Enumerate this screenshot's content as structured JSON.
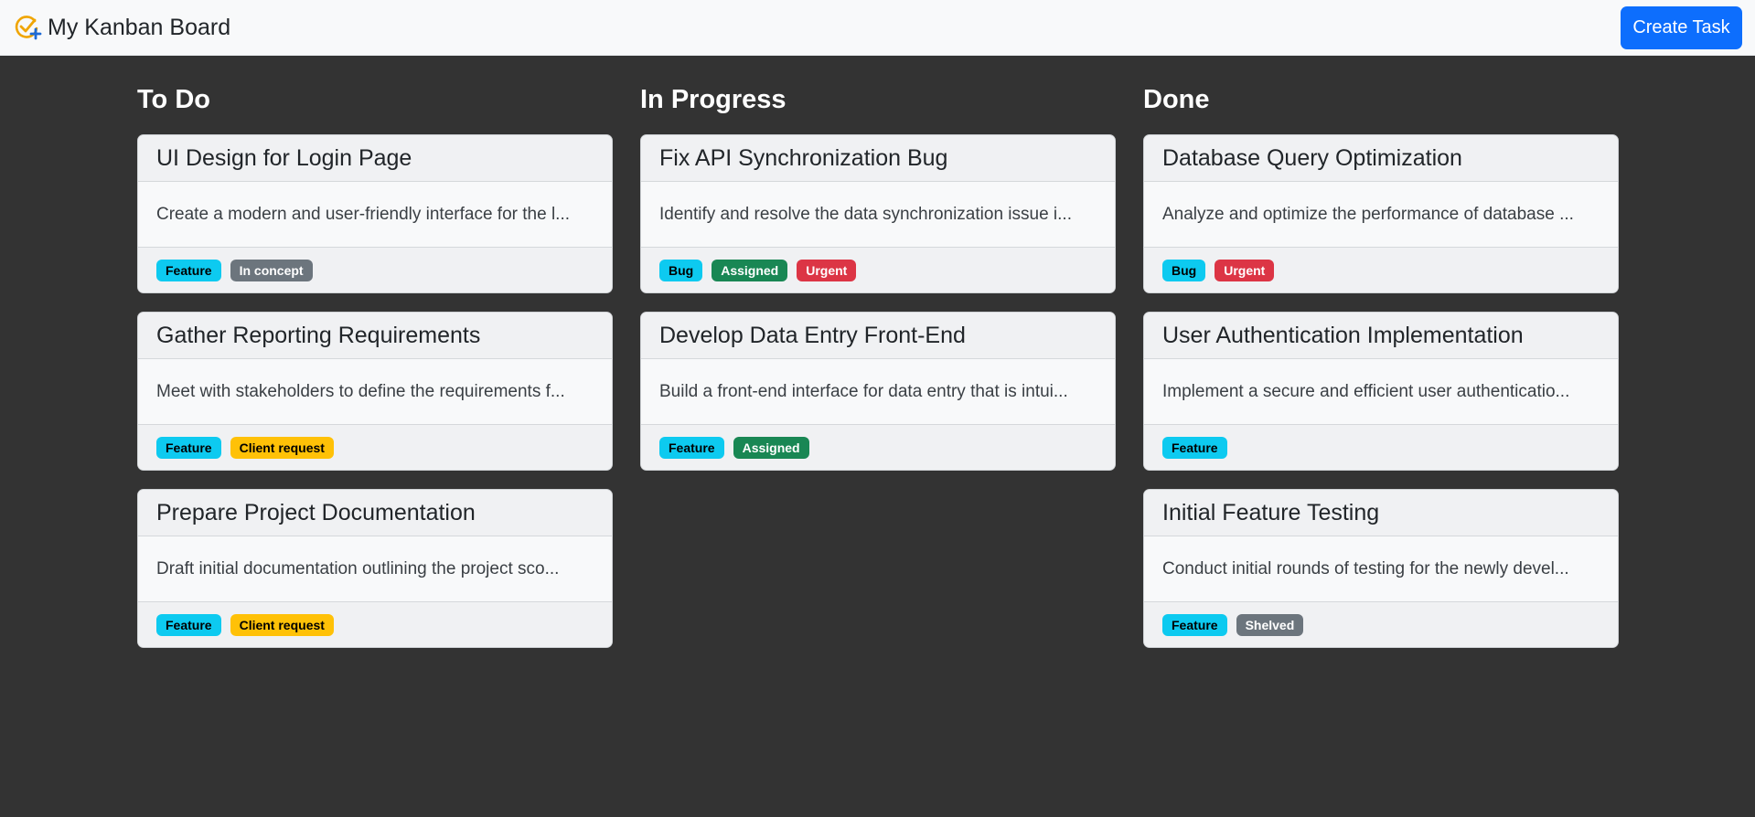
{
  "navbar": {
    "title": "My Kanban Board",
    "create_button": "Create Task"
  },
  "colors": {
    "primary": "#0d6efd",
    "info": "#0dcaf0",
    "secondary": "#6c757d",
    "success": "#198754",
    "danger": "#dc3545",
    "warning": "#ffc107",
    "background": "#333333"
  },
  "columns": [
    {
      "title": "To Do",
      "cards": [
        {
          "title": "UI Design for Login Page",
          "description": "Create a modern and user-friendly interface for the l...",
          "badges": [
            {
              "label": "Feature",
              "variant": "info"
            },
            {
              "label": "In concept",
              "variant": "secondary"
            }
          ]
        },
        {
          "title": "Gather Reporting Requirements",
          "description": "Meet with stakeholders to define the requirements f...",
          "badges": [
            {
              "label": "Feature",
              "variant": "info"
            },
            {
              "label": "Client request",
              "variant": "warning"
            }
          ]
        },
        {
          "title": "Prepare Project Documentation",
          "description": "Draft initial documentation outlining the project sco...",
          "badges": [
            {
              "label": "Feature",
              "variant": "info"
            },
            {
              "label": "Client request",
              "variant": "warning"
            }
          ]
        }
      ]
    },
    {
      "title": "In Progress",
      "cards": [
        {
          "title": "Fix API Synchronization Bug",
          "description": "Identify and resolve the data synchronization issue i...",
          "badges": [
            {
              "label": "Bug",
              "variant": "info"
            },
            {
              "label": "Assigned",
              "variant": "success"
            },
            {
              "label": "Urgent",
              "variant": "danger"
            }
          ]
        },
        {
          "title": "Develop Data Entry Front-End",
          "description": "Build a front-end interface for data entry that is intui...",
          "badges": [
            {
              "label": "Feature",
              "variant": "info"
            },
            {
              "label": "Assigned",
              "variant": "success"
            }
          ]
        }
      ]
    },
    {
      "title": "Done",
      "cards": [
        {
          "title": "Database Query Optimization",
          "description": "Analyze and optimize the performance of database ...",
          "badges": [
            {
              "label": "Bug",
              "variant": "info"
            },
            {
              "label": "Urgent",
              "variant": "danger"
            }
          ]
        },
        {
          "title": "User Authentication Implementation",
          "description": "Implement a secure and efficient user authenticatio...",
          "badges": [
            {
              "label": "Feature",
              "variant": "info"
            }
          ]
        },
        {
          "title": "Initial Feature Testing",
          "description": "Conduct initial rounds of testing for the newly devel...",
          "badges": [
            {
              "label": "Feature",
              "variant": "info"
            },
            {
              "label": "Shelved",
              "variant": "secondary"
            }
          ]
        }
      ]
    }
  ]
}
